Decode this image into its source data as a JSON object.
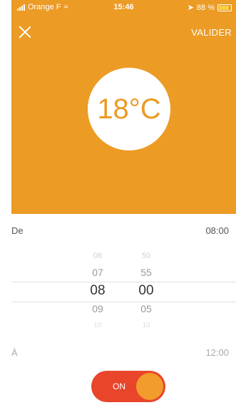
{
  "status": {
    "carrier": "Orange F",
    "time": "15:46",
    "battery": "88 %"
  },
  "header": {
    "validate": "VALIDER"
  },
  "temperature": "18°C",
  "from": {
    "label": "De",
    "value": "08:00"
  },
  "to": {
    "label": "À",
    "value": "12:00"
  },
  "picker": {
    "hours": [
      "06",
      "07",
      "08",
      "09",
      "10"
    ],
    "minutes": [
      "50",
      "55",
      "00",
      "05",
      "10"
    ]
  },
  "toggle": {
    "label": "ON"
  },
  "colors": {
    "accent": "#ec9b24",
    "toggle": "#e8452a"
  }
}
